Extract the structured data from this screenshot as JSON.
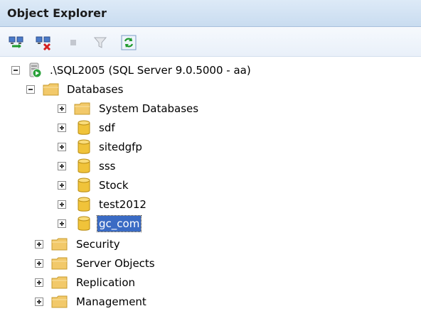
{
  "panel": {
    "title": "Object Explorer"
  },
  "toolbar": {
    "buttons": [
      {
        "icon": "connect-icon"
      },
      {
        "icon": "disconnect-icon"
      },
      {
        "icon": "stop-icon"
      },
      {
        "icon": "filter-icon"
      },
      {
        "icon": "refresh-icon"
      }
    ]
  },
  "tree": {
    "server": {
      "label": ".\\SQL2005 (SQL Server 9.0.5000 - aa)",
      "expanded": true
    },
    "databases": {
      "label": "Databases",
      "expanded": true
    },
    "database_children": [
      {
        "label": "System Databases",
        "type": "folder"
      },
      {
        "label": "sdf",
        "type": "database"
      },
      {
        "label": "sitedgfp",
        "type": "database"
      },
      {
        "label": "sss",
        "type": "database"
      },
      {
        "label": "Stock",
        "type": "database"
      },
      {
        "label": "test2012",
        "type": "database"
      },
      {
        "label": "gc_com",
        "type": "database",
        "selected": true
      }
    ],
    "server_folders": [
      {
        "label": "Security"
      },
      {
        "label": "Server Objects"
      },
      {
        "label": "Replication"
      },
      {
        "label": "Management"
      }
    ]
  },
  "colors": {
    "title_bar": "#c9dcf0",
    "folder": "#f2c96a",
    "database": "#f0c33a",
    "selection": "#3a6bc4"
  }
}
